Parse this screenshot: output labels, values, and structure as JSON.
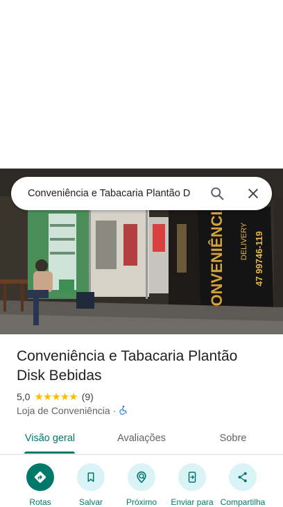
{
  "search": {
    "query": "Conveniência e Tabacaria Plantão D"
  },
  "place": {
    "title": "Conveniência e Tabacaria Plantão Disk Bebidas",
    "rating": "5,0",
    "stars": "★★★★★",
    "review_count": "(9)",
    "category": "Loja de Conveniência",
    "separator": "·"
  },
  "photo": {
    "sign_text": "CONVENIÊNCIA",
    "delivery_text": "DELIVERY",
    "phone_text": "47 99746-119"
  },
  "tabs": [
    {
      "label": "Visão geral",
      "active": true
    },
    {
      "label": "Avaliações",
      "active": false
    },
    {
      "label": "Sobre",
      "active": false
    }
  ],
  "actions": [
    {
      "label": "Rotas",
      "icon": "directions-icon"
    },
    {
      "label": "Salvar",
      "icon": "bookmark-icon"
    },
    {
      "label": "Próximo",
      "icon": "nearby-icon"
    },
    {
      "label": "Enviar para",
      "icon": "send-to-phone-icon"
    },
    {
      "label": "Compartilha",
      "icon": "share-icon"
    }
  ],
  "colors": {
    "accent": "#00796b",
    "action_bg": "#d9f3f6",
    "star": "#fbbc04",
    "accessibility": "#1a73e8"
  }
}
